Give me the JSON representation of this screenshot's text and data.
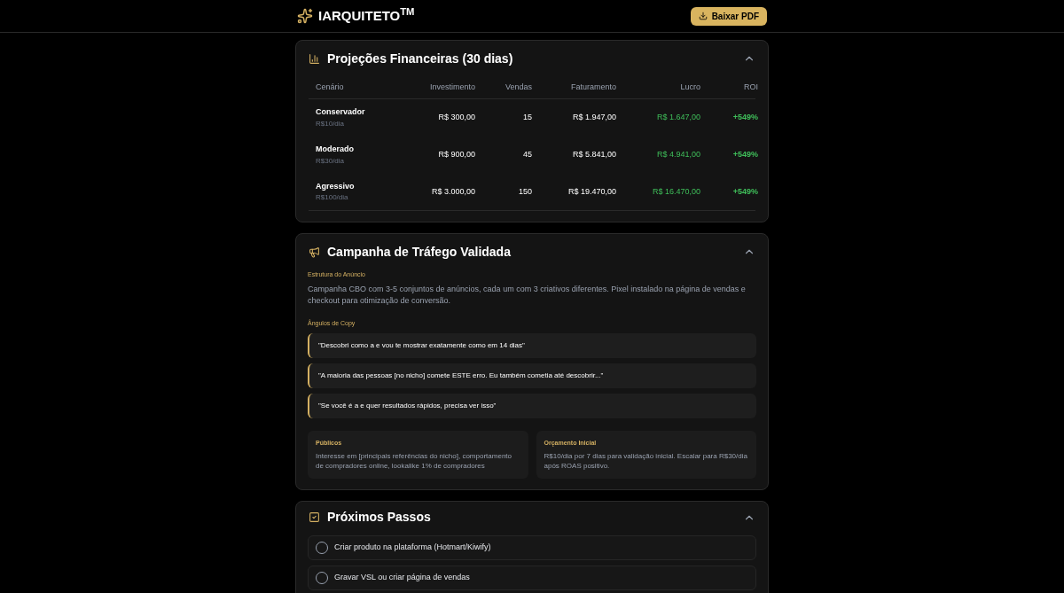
{
  "header": {
    "logo": "IARQUITETO$^{TM}$",
    "download_button": "Baixar PDF"
  },
  "projections": {
    "title": "Projeções Financeiras (30 dias)",
    "expanded": true,
    "columns": [
      "Cenário",
      "Investimento",
      "Vendas",
      "Faturamento",
      "Lucro",
      "ROI"
    ],
    "rows": [
      {
        "scenario": "Conservador",
        "daily": "R$10/dia",
        "investment": "R$ 300,00",
        "sales": "15",
        "revenue": "R$ 1.947,00",
        "profit": "R$ 1.647,00",
        "roi": "+549%"
      },
      {
        "scenario": "Moderado",
        "daily": "R$30/dia",
        "investment": "R$ 900,00",
        "sales": "45",
        "revenue": "R$ 5.841,00",
        "profit": "R$ 4.941,00",
        "roi": "+549%"
      },
      {
        "scenario": "Agressivo",
        "daily": "R$100/dia",
        "investment": "R$ 3.000,00",
        "sales": "150",
        "revenue": "R$ 19.470,00",
        "profit": "R$ 16.470,00",
        "roi": "+549%"
      }
    ]
  },
  "campaign": {
    "title": "Campanha de Tráfego Validada",
    "expanded": true,
    "structure_label": "Estrutura do Anúncio",
    "structure_text": "Campanha CBO com 3-5 conjuntos de anúncios, cada um com 3 criativos diferentes. Pixel instalado na página de vendas e checkout para otimização de conversão.",
    "angles_label": "Ângulos de Copy",
    "angles": [
      "\"Descobri como a e vou te mostrar exatamente como em 14 dias\"",
      "\"A maioria das pessoas [no nicho] comete ESTE erro. Eu também cometia até descobrir...\"",
      "\"Se você é a e quer resultados rápidos, precisa ver isso\""
    ],
    "info_cards": [
      {
        "label": "Públicos",
        "text": "Interesse em [principais referências do nicho], comportamento de compradores online, lookalike 1% de compradores"
      },
      {
        "label": "Orçamento Inicial",
        "text": "R$10/dia por 7 dias para validação inicial. Escalar para R$30/dia após ROAS positivo."
      }
    ]
  },
  "next_steps": {
    "title": "Próximos Passos",
    "expanded": true,
    "items": [
      {
        "label": "Criar produto na plataforma (Hotmart/Kiwify)",
        "checked": false
      },
      {
        "label": "Gravar VSL ou criar página de vendas",
        "checked": false
      }
    ]
  }
}
